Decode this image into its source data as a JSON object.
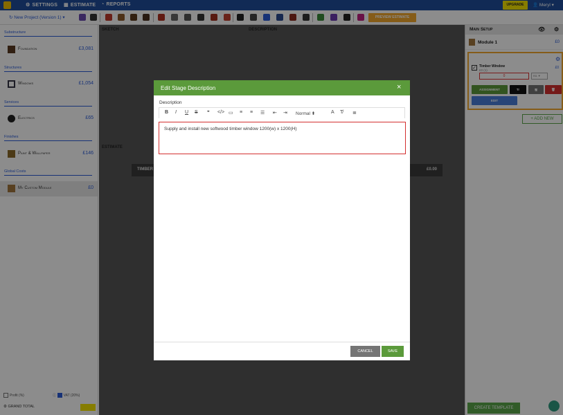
{
  "topnav": {
    "settings": "SETTINGS",
    "estimate": "ESTIMATE",
    "reports": "REPORTS",
    "upgrade": "UPGRADE",
    "user": "Meryl"
  },
  "toolbar": {
    "project": "New Project (Version 1)",
    "preview": "PREVIEW ESTIMATE"
  },
  "left": {
    "sections": [
      {
        "header": "Substructure",
        "item": "Foundation",
        "value": "£3,081"
      },
      {
        "header": "Structures",
        "item": "Windows",
        "value": "£1,054"
      },
      {
        "header": "Services",
        "item": "Electrics",
        "value": "£65"
      },
      {
        "header": "Finishes",
        "item": "Paint & Wallpaper",
        "value": "£146"
      },
      {
        "header": "Global Costs",
        "item": "My Custom Module",
        "value": "£0"
      }
    ],
    "footer": {
      "profit": "Profit (%)",
      "vat": "VAT (20%)",
      "grand_total": "GRAND TOTAL"
    }
  },
  "middle": {
    "col_sketch": "SKETCH",
    "col_description": "DESCRIPTION",
    "col_estimate": "ESTIMATE",
    "timber_label": "TIMBER",
    "timber_value": "£0.00"
  },
  "right": {
    "title": "Main Setup",
    "module_name": "Module 1",
    "module_value": "£0",
    "stage_name": "Timber Window",
    "stage_sub": "£0 (1)",
    "stage_value": "£0",
    "qty": "0",
    "unit": "no.",
    "buttons": {
      "assignment": "ASSIGNMENT",
      "tx": "Tr",
      "edit": "EDIT"
    },
    "add_new": "+ ADD NEW",
    "create_template": "CREATE TEMPLATE"
  },
  "modal": {
    "title": "Edit Stage Description",
    "label": "Description",
    "format_select": "Normal",
    "text": "Supply and install new softwood timber window 1200(w) x 1200(H)",
    "cancel": "CANCEL",
    "save": "SAVE"
  },
  "colors": {
    "nav_blue": "#1f4e9c",
    "accent_blue": "#2a5bd7",
    "green": "#5b9a3b",
    "orange": "#f2a82c",
    "yellow": "#f5e400",
    "red": "#d32f2f"
  }
}
